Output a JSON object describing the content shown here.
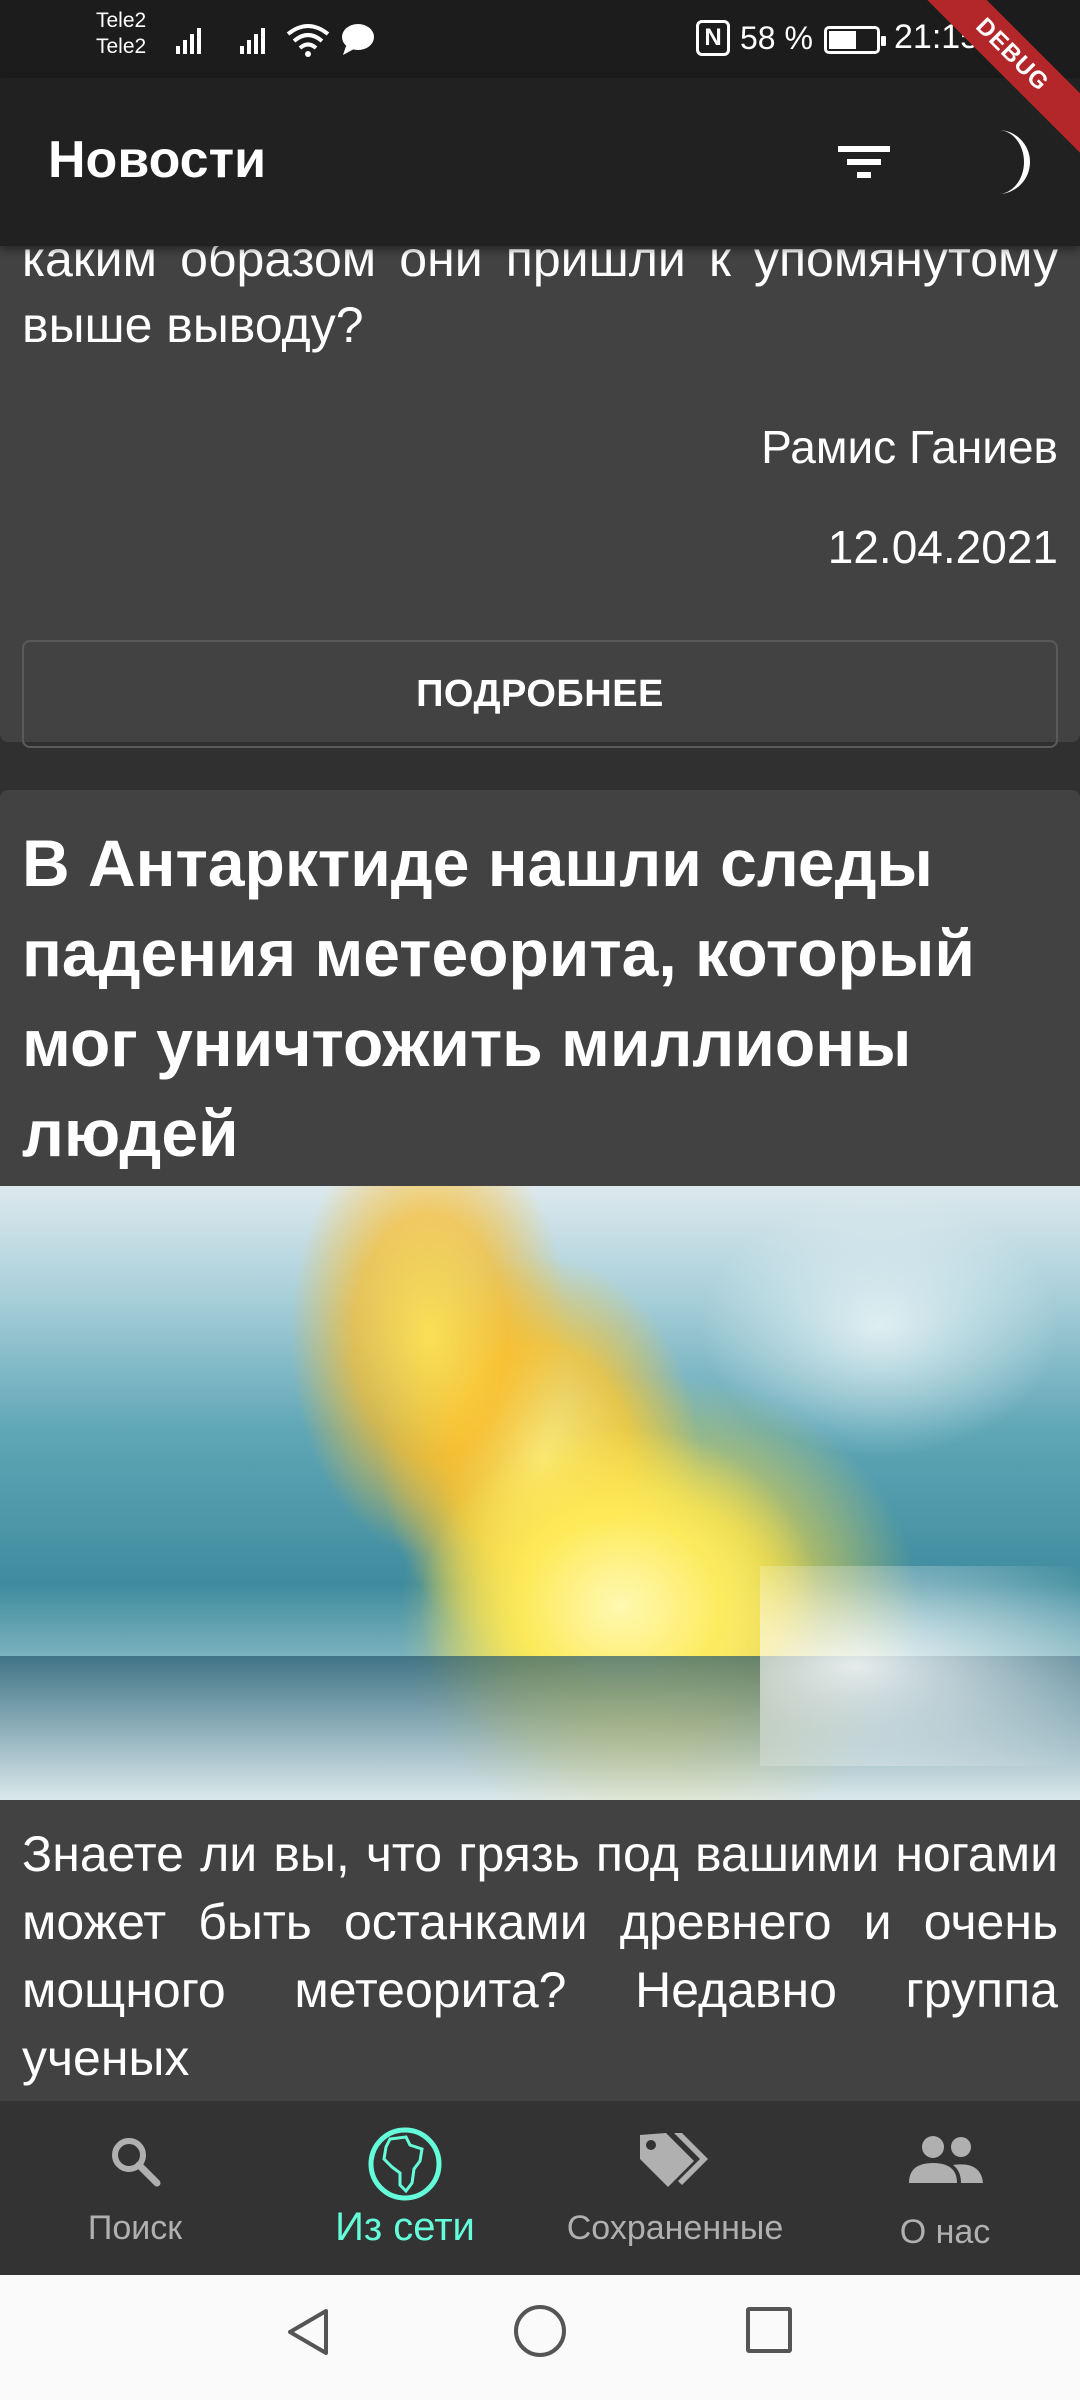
{
  "status_bar": {
    "carrier_1": "Tele2",
    "carrier_2": "Tele2",
    "battery_percent": "58 %",
    "battery_level": 0.58,
    "time": "21:15"
  },
  "debug_banner": "DEBUG",
  "app_bar": {
    "title": "Новости",
    "filter_icon": "filter-list-icon",
    "theme_icon": "moon-icon"
  },
  "feed": {
    "card_1": {
      "description_tail": "каким образом они пришли к упомянутому выше выводу?",
      "author": "Рамис Ганиев",
      "date": "12.04.2021",
      "more_label": "ПОДРОБНЕЕ"
    },
    "card_2": {
      "title": "В Антарктиде нашли следы падения метеорита, который мог уничтожить миллионы людей",
      "description": "Знаете ли вы, что грязь под вашими ногами может быть останками древнего и очень мощного метеорита? Недавно группа ученых"
    }
  },
  "bottom_nav": {
    "items": [
      {
        "label": "Поиск",
        "icon": "search-icon",
        "active": false
      },
      {
        "label": "Из сети",
        "icon": "globe-africa-icon",
        "active": true
      },
      {
        "label": "Сохраненные",
        "icon": "tags-icon",
        "active": false
      },
      {
        "label": "О нас",
        "icon": "people-icon",
        "active": false
      }
    ]
  },
  "colors": {
    "accent": "#64ffda",
    "app_bar": "#212121",
    "card": "#424242",
    "background": "#303030",
    "debug": "#b3262a"
  }
}
